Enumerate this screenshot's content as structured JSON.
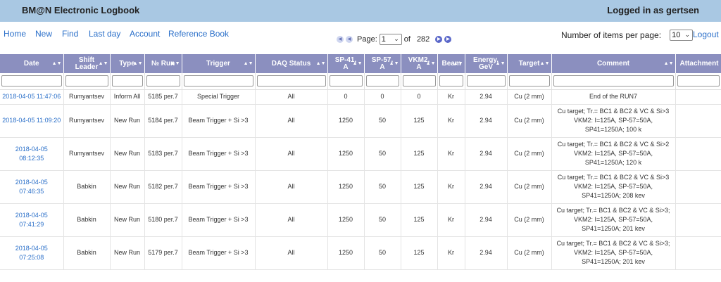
{
  "header": {
    "title": "BM@N Electronic Logbook",
    "login": "Logged in as gertsen"
  },
  "nav": [
    "Home",
    "New",
    "Find",
    "Last day",
    "Account",
    "Reference Book"
  ],
  "pager": {
    "page_label": "Page:",
    "current_page": "1",
    "of_label": "of",
    "total_pages": "282"
  },
  "items_per_page": {
    "label": "Number of items per page:",
    "value": "10"
  },
  "logout": "Logout",
  "columns": [
    "Date",
    "Shift Leader",
    "Type",
    "№ Run",
    "Trigger",
    "DAQ Status",
    "SP-41, A",
    "SP-57, A",
    "VKM2, A",
    "Beam",
    "Energy, GeV",
    "Target",
    "Comment",
    "Attachment"
  ],
  "rows": [
    [
      "2018-04-05 11:47:06",
      "Rumyantsev",
      "Inform All",
      "5185 per.7",
      "Special Trigger",
      "All",
      "0",
      "0",
      "0",
      "Kr",
      "2.94",
      "Cu (2 mm)",
      "End of the RUN7",
      ""
    ],
    [
      "2018-04-05 11:09:20",
      "Rumyantsev",
      "New Run",
      "5184 per.7",
      "Beam Trigger + Si >3",
      "All",
      "1250",
      "50",
      "125",
      "Kr",
      "2.94",
      "Cu (2 mm)",
      "Cu target; Tr.= BC1 & BC2 & VC & Si>3 VKM2: I=125A, SP-57=50A, SP41=1250A; 100 k",
      ""
    ],
    [
      "2018-04-05 08:12:35",
      "Rumyantsev",
      "New Run",
      "5183 per.7",
      "Beam Trigger + Si >3",
      "All",
      "1250",
      "50",
      "125",
      "Kr",
      "2.94",
      "Cu (2 mm)",
      "Cu target; Tr.= BC1 & BC2 & VC & Si>2 VKM2: I=125A, SP-57=50A, SP41=1250A; 120 k",
      ""
    ],
    [
      "2018-04-05 07:46:35",
      "Babkin",
      "New Run",
      "5182 per.7",
      "Beam Trigger + Si >3",
      "All",
      "1250",
      "50",
      "125",
      "Kr",
      "2.94",
      "Cu (2 mm)",
      "Cu target; Tr.= BC1 & BC2 & VC & Si>3 VKM2: I=125A, SP-57=50A, SP41=1250A; 208 kev",
      ""
    ],
    [
      "2018-04-05 07:41:29",
      "Babkin",
      "New Run",
      "5180 per.7",
      "Beam Trigger + Si >3",
      "All",
      "1250",
      "50",
      "125",
      "Kr",
      "2.94",
      "Cu (2 mm)",
      "Cu target; Tr.= BC1 & BC2 & VC & Si>3; VKM2: I=125A, SP-57=50A, SP41=1250A; 201 kev",
      ""
    ],
    [
      "2018-04-05 07:25:08",
      "Babkin",
      "New Run",
      "5179 per.7",
      "Beam Trigger + Si >3",
      "All",
      "1250",
      "50",
      "125",
      "Kr",
      "2.94",
      "Cu (2 mm)",
      "Cu target; Tr.= BC1 & BC2 & VC & Si>3; VKM2: I=125A, SP-57=50A, SP41=1250A; 201 kev",
      ""
    ]
  ]
}
